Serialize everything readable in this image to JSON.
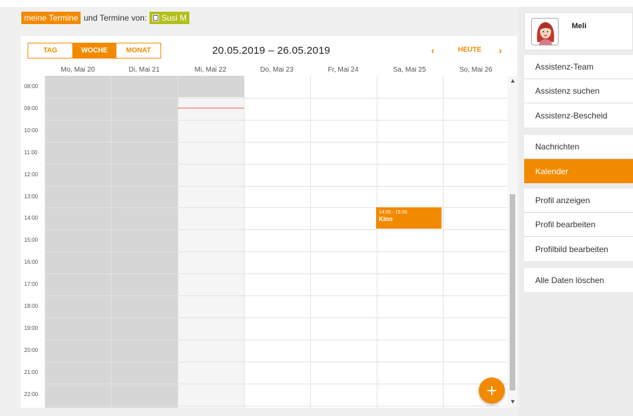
{
  "filter": {
    "own_label": "meine Termine",
    "connector_text": "und Termine von:",
    "person_label": "Susi M"
  },
  "calendar": {
    "views": [
      {
        "label": "TAG",
        "active": false
      },
      {
        "label": "WOCHE",
        "active": true
      },
      {
        "label": "MONAT",
        "active": false
      }
    ],
    "range_title": "20.05.2019 – 26.05.2019",
    "prev_label": "‹",
    "today_label": "HEUTE",
    "next_label": "›",
    "days": [
      "Mo, Mai 20",
      "Di, Mai 21",
      "Mi, Mai 22",
      "Do, Mai 23",
      "Fr, Mai 24",
      "Sa, Mai 25",
      "So, Mai 26"
    ],
    "hours": [
      "08:00",
      "09:00",
      "10:00",
      "11:00",
      "12:00",
      "13:00",
      "14:00",
      "15:00",
      "16:00",
      "17:00",
      "18:00",
      "19:00",
      "20:00",
      "21:00",
      "22:00"
    ],
    "event": {
      "time": "14:00 - 15:00",
      "title": "Kino"
    },
    "add_label": "+"
  },
  "colors": {
    "accent": "#f28a00",
    "person_badge": "#b3bf1a",
    "past_day": "#d6d6d6",
    "today_column": "#f5f5f5",
    "now_line": "#f6a89a"
  },
  "sidebar": {
    "profile_name": "Meli",
    "groups": [
      [
        "Assistenz-Team",
        "Assistenz suchen",
        "Assistenz-Bescheid"
      ],
      [
        "Nachrichten",
        "Kalender"
      ],
      [
        "Profil anzeigen",
        "Profil bearbeiten",
        "Profilbild bearbeiten"
      ],
      [
        "Alle Daten löschen"
      ]
    ],
    "active_item": "Kalender"
  }
}
